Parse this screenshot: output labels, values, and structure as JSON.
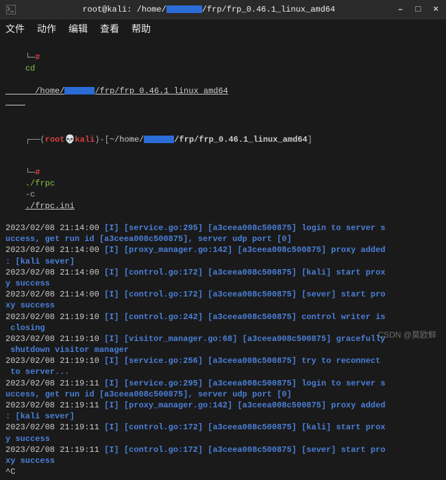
{
  "titlebar": {
    "title_prefix": "root@kali: /home/",
    "title_suffix": "/frp/frp_0.46.1_linux_amd64"
  },
  "windowControls": {
    "minimize": "–",
    "maximize": "□",
    "close": "×"
  },
  "menubar": {
    "file": "文件",
    "actions": "动作",
    "edit": "编辑",
    "view": "查看",
    "help": "帮助"
  },
  "prompt1": {
    "dash": "└─",
    "hash": "#",
    "cmd": "cd",
    "path_pre": "/home/",
    "path_post": "/frp/frp 0.46.1 linux amd64"
  },
  "prompt2": {
    "left_open": "┌──(",
    "user": "root",
    "skull": "💀",
    "host": "kali",
    "left_close": ")-[",
    "tilde": "~",
    "path_pre": "/home/",
    "path_post": "/frp/frp_0.46.1_linux_amd64",
    "right": "]",
    "dash": "└─",
    "hash": "#",
    "cmd": "./frpc",
    "flag": "-c",
    "arg": "./frpc.ini"
  },
  "logs": [
    {
      "ts": "2023/02/08 21:14:00",
      "text_a": "[I] [service.go:295] [a3ceea008c500875] login to server s",
      "cont": "uccess, get run id [a3ceea008c500875], server udp port [0]"
    },
    {
      "ts": "2023/02/08 21:14:00",
      "text_a": "[I] [proxy_manager.go:142] [a3ceea008c500875] proxy added",
      "cont": ": [kali sever]"
    },
    {
      "ts": "2023/02/08 21:14:00",
      "text_a": "[I] [control.go:172] [a3ceea008c500875] [kali] start prox",
      "cont": "y success"
    },
    {
      "ts": "2023/02/08 21:14:00",
      "text_a": "[I] [control.go:172] [a3ceea008c500875] [sever] start pro",
      "cont": "xy success"
    },
    {
      "ts": "2023/02/08 21:19:10",
      "text_a": "[I] [control.go:242] [a3ceea008c500875] control writer is",
      "cont": " closing"
    },
    {
      "ts": "2023/02/08 21:19:10",
      "text_a": "[I] [visitor_manager.go:68] [a3ceea008c500875] gracefully",
      "cont": " shutdown visitor manager"
    },
    {
      "ts": "2023/02/08 21:19:10",
      "text_a": "[I] [service.go:256] [a3ceea008c500875] try to reconnect",
      "cont": " to server..."
    },
    {
      "ts": "2023/02/08 21:19:11",
      "text_a": "[I] [service.go:295] [a3ceea008c500875] login to server s",
      "cont": "uccess, get run id [a3ceea008c500875], server udp port [0]"
    },
    {
      "ts": "2023/02/08 21:19:11",
      "text_a": "[I] [proxy_manager.go:142] [a3ceea008c500875] proxy added",
      "cont": ": [kali sever]"
    },
    {
      "ts": "2023/02/08 21:19:11",
      "text_a": "[I] [control.go:172] [a3ceea008c500875] [kali] start prox",
      "cont": "y success"
    },
    {
      "ts": "2023/02/08 21:19:11",
      "text_a": "[I] [control.go:172] [a3ceea008c500875] [sever] start pro",
      "cont": "xy success"
    }
  ],
  "ctrlc": "^C",
  "watermark": "CSDN @莫欧鲜"
}
